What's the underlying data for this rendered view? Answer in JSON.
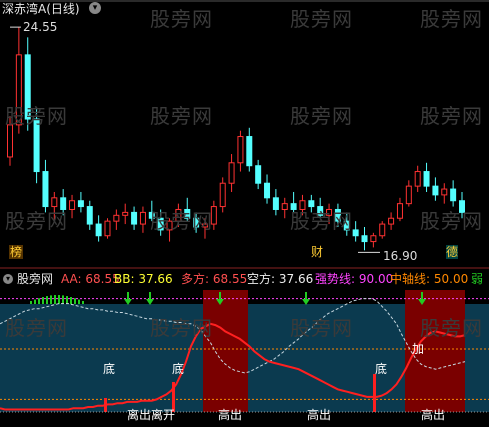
{
  "header": {
    "title": "深赤湾A(日线)",
    "high_label": "24.55",
    "low_label": "16.90",
    "tag_left": "榜",
    "tag_mid": "财",
    "tag_right": "德"
  },
  "watermark": "股旁网",
  "indicator": {
    "name": "股旁网",
    "aa_label": "AA: 68.55",
    "bb_label": "BB: 37.66",
    "duo_label": "多方: 68.55",
    "kong_label": "空方: 37.66",
    "strong_label": "强势线: 90.00",
    "mid_label": "中轴线: 50.00",
    "weak_label": "弱"
  },
  "annotations": {
    "bottom_labels": [
      "底",
      "底",
      "底"
    ],
    "jia": "加",
    "gaochu": [
      "高出",
      "高出",
      "高出"
    ],
    "mixed_bottom": "离出离开"
  },
  "colors": {
    "up": "#ff3232",
    "down": "#54ffff",
    "panel_bg": "#0b3a4f",
    "red_zone": "#7a0000",
    "arrow": "#22cc22",
    "strong": "#ff44ff",
    "mid": "#ff8800"
  },
  "candles": [
    [
      20.1,
      21.5,
      19.8,
      21.2
    ],
    [
      21.2,
      24.55,
      20.9,
      23.6
    ],
    [
      23.6,
      24.2,
      21.0,
      21.4
    ],
    [
      21.4,
      21.8,
      19.2,
      19.6
    ],
    [
      19.6,
      20.0,
      18.2,
      18.4
    ],
    [
      18.4,
      18.9,
      17.9,
      18.7
    ],
    [
      18.7,
      19.0,
      18.1,
      18.3
    ],
    [
      18.3,
      18.8,
      18.0,
      18.6
    ],
    [
      18.6,
      18.9,
      18.2,
      18.4
    ],
    [
      18.4,
      18.6,
      17.6,
      17.8
    ],
    [
      17.8,
      18.1,
      17.2,
      17.4
    ],
    [
      17.4,
      18.0,
      17.3,
      17.9
    ],
    [
      17.9,
      18.3,
      17.6,
      18.1
    ],
    [
      18.1,
      18.5,
      17.8,
      18.2
    ],
    [
      18.2,
      18.4,
      17.6,
      17.8
    ],
    [
      17.8,
      18.4,
      17.5,
      18.2
    ],
    [
      18.2,
      18.6,
      17.9,
      18.0
    ],
    [
      18.0,
      18.3,
      17.4,
      17.6
    ],
    [
      17.6,
      18.0,
      17.2,
      17.9
    ],
    [
      17.9,
      18.5,
      17.7,
      18.3
    ],
    [
      18.3,
      18.7,
      17.9,
      18.0
    ],
    [
      18.0,
      18.2,
      17.5,
      17.7
    ],
    [
      17.7,
      18.0,
      17.3,
      17.8
    ],
    [
      17.8,
      18.6,
      17.6,
      18.4
    ],
    [
      18.4,
      19.4,
      18.2,
      19.2
    ],
    [
      19.2,
      20.2,
      18.9,
      19.9
    ],
    [
      19.9,
      21.0,
      19.6,
      20.8
    ],
    [
      20.8,
      21.1,
      19.6,
      19.8
    ],
    [
      19.8,
      20.0,
      19.0,
      19.2
    ],
    [
      19.2,
      19.5,
      18.5,
      18.7
    ],
    [
      18.7,
      19.0,
      18.1,
      18.3
    ],
    [
      18.3,
      18.7,
      18.0,
      18.5
    ],
    [
      18.5,
      18.9,
      18.2,
      18.3
    ],
    [
      18.3,
      18.8,
      18.1,
      18.6
    ],
    [
      18.6,
      18.8,
      18.2,
      18.4
    ],
    [
      18.4,
      18.7,
      18.0,
      18.1
    ],
    [
      18.1,
      18.5,
      17.8,
      18.3
    ],
    [
      18.3,
      18.5,
      17.7,
      17.9
    ],
    [
      17.9,
      18.2,
      17.4,
      17.6
    ],
    [
      17.6,
      17.9,
      17.2,
      17.4
    ],
    [
      17.4,
      17.7,
      16.9,
      17.2
    ],
    [
      17.2,
      17.5,
      17.0,
      17.4
    ],
    [
      17.4,
      17.9,
      17.3,
      17.8
    ],
    [
      17.8,
      18.2,
      17.6,
      18.0
    ],
    [
      18.0,
      18.7,
      17.9,
      18.5
    ],
    [
      18.5,
      19.3,
      18.4,
      19.1
    ],
    [
      19.1,
      19.8,
      18.9,
      19.6
    ],
    [
      19.6,
      19.9,
      18.9,
      19.1
    ],
    [
      19.1,
      19.4,
      18.6,
      18.8
    ],
    [
      18.8,
      19.2,
      18.5,
      19.0
    ],
    [
      19.0,
      19.3,
      18.4,
      18.6
    ],
    [
      18.6,
      18.9,
      18.0,
      18.2
    ]
  ],
  "indicator_line": [
    3,
    2,
    2,
    2,
    2,
    2,
    2,
    2,
    2,
    2,
    2,
    2,
    2,
    2,
    2,
    3,
    3,
    3,
    4,
    4,
    5,
    5,
    6,
    6,
    7,
    7,
    8,
    8,
    8,
    9,
    9,
    9,
    10,
    12,
    14,
    17,
    22,
    30,
    40,
    52,
    60,
    66,
    68,
    70,
    69,
    67,
    64,
    62,
    60,
    58,
    55,
    52,
    48,
    45,
    42,
    40,
    39,
    38,
    37,
    36,
    35,
    34,
    32,
    30,
    28,
    26,
    24,
    22,
    20,
    18,
    17,
    16,
    15,
    14,
    13,
    12,
    12,
    12,
    13,
    15,
    18,
    22,
    28,
    35,
    43,
    50,
    56,
    60,
    63,
    64,
    63,
    62,
    61,
    60,
    60,
    61
  ],
  "dashed_line": [
    70,
    72,
    74,
    76,
    78,
    80,
    81,
    82,
    82,
    83,
    84,
    85,
    86,
    86,
    86,
    85,
    84,
    83,
    82,
    82,
    81,
    81,
    80,
    80,
    79,
    79,
    78,
    77,
    76,
    75,
    74,
    74,
    73,
    73,
    72,
    72,
    71,
    71,
    70,
    70,
    68,
    65,
    60,
    55,
    48,
    42,
    38,
    35,
    33,
    32,
    31,
    32,
    34,
    36,
    38,
    40,
    42,
    45,
    48,
    52,
    55,
    58,
    62,
    65,
    68,
    72,
    75,
    78,
    80,
    82,
    84,
    86,
    88,
    89,
    90,
    90,
    90,
    88,
    84,
    80,
    75,
    70,
    62,
    55,
    48,
    42,
    38,
    36,
    35,
    34,
    35,
    36,
    37,
    38,
    39,
    40
  ]
}
